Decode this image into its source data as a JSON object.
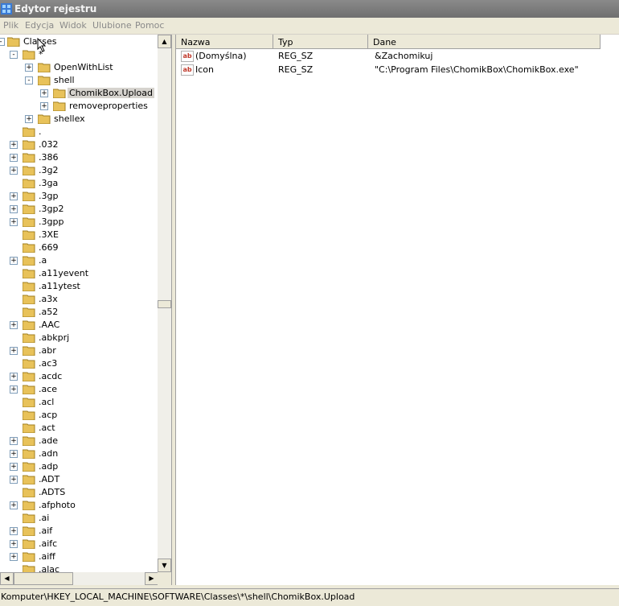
{
  "window": {
    "title": "Edytor rejestru"
  },
  "menu": [
    "Plik",
    "Edycja",
    "Widok",
    "Ulubione",
    "Pomoc"
  ],
  "tree": {
    "root_label": "Classes",
    "star_label": "*",
    "nodes": [
      {
        "label": "OpenWithList",
        "expander": "+"
      },
      {
        "label": "shell",
        "expander": "-"
      },
      {
        "label": "ChomikBox.Upload",
        "expander": "+",
        "selected": true
      },
      {
        "label": "removeproperties",
        "expander": "+"
      },
      {
        "label": "shellex",
        "expander": "+"
      },
      {
        "label": ".",
        "expander": ""
      },
      {
        "label": ".032",
        "expander": "+"
      },
      {
        "label": ".386",
        "expander": "+"
      },
      {
        "label": ".3g2",
        "expander": "+"
      },
      {
        "label": ".3ga",
        "expander": ""
      },
      {
        "label": ".3gp",
        "expander": "+"
      },
      {
        "label": ".3gp2",
        "expander": "+"
      },
      {
        "label": ".3gpp",
        "expander": "+"
      },
      {
        "label": ".3XE",
        "expander": ""
      },
      {
        "label": ".669",
        "expander": ""
      },
      {
        "label": ".a",
        "expander": "+"
      },
      {
        "label": ".a11yevent",
        "expander": ""
      },
      {
        "label": ".a11ytest",
        "expander": ""
      },
      {
        "label": ".a3x",
        "expander": ""
      },
      {
        "label": ".a52",
        "expander": ""
      },
      {
        "label": ".AAC",
        "expander": "+"
      },
      {
        "label": ".abkprj",
        "expander": ""
      },
      {
        "label": ".abr",
        "expander": "+"
      },
      {
        "label": ".ac3",
        "expander": ""
      },
      {
        "label": ".acdc",
        "expander": "+"
      },
      {
        "label": ".ace",
        "expander": "+"
      },
      {
        "label": ".acl",
        "expander": ""
      },
      {
        "label": ".acp",
        "expander": ""
      },
      {
        "label": ".act",
        "expander": ""
      },
      {
        "label": ".ade",
        "expander": "+"
      },
      {
        "label": ".adn",
        "expander": "+"
      },
      {
        "label": ".adp",
        "expander": "+"
      },
      {
        "label": ".ADT",
        "expander": "+"
      },
      {
        "label": ".ADTS",
        "expander": ""
      },
      {
        "label": ".afphoto",
        "expander": "+"
      },
      {
        "label": ".ai",
        "expander": ""
      },
      {
        "label": ".aif",
        "expander": "+"
      },
      {
        "label": ".aifc",
        "expander": "+"
      },
      {
        "label": ".aiff",
        "expander": "+"
      },
      {
        "label": ".alac",
        "expander": ""
      }
    ]
  },
  "list": {
    "columns": [
      "Nazwa",
      "Typ",
      "Dane"
    ],
    "rows": [
      {
        "name": "(Domyślna)",
        "type": "REG_SZ",
        "data": "&Zachomikuj"
      },
      {
        "name": "Icon",
        "type": "REG_SZ",
        "data": "\"C:\\Program Files\\ChomikBox\\ChomikBox.exe\""
      }
    ]
  },
  "icons": {
    "value_icon": "ab"
  },
  "status": {
    "path": "Komputer\\HKEY_LOCAL_MACHINE\\SOFTWARE\\Classes\\*\\shell\\ChomikBox.Upload"
  }
}
